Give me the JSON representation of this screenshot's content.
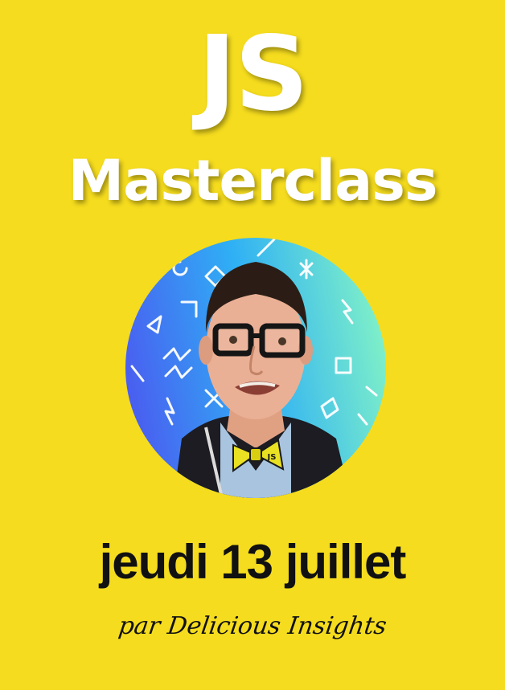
{
  "poster": {
    "title_line1": "JS",
    "title_line2": "Masterclass",
    "date": "jeudi 13 juillet",
    "byline": "par Delicious Insights",
    "background_color": "#f5dc1e",
    "title_color": "#ffffff",
    "text_color": "#111111"
  },
  "avatar": {
    "icon": "speaker-portrait",
    "gradient_colors": [
      "#4a5cf0",
      "#2fb0f5",
      "#7ff0c8"
    ],
    "bowtie_text": "JS"
  }
}
